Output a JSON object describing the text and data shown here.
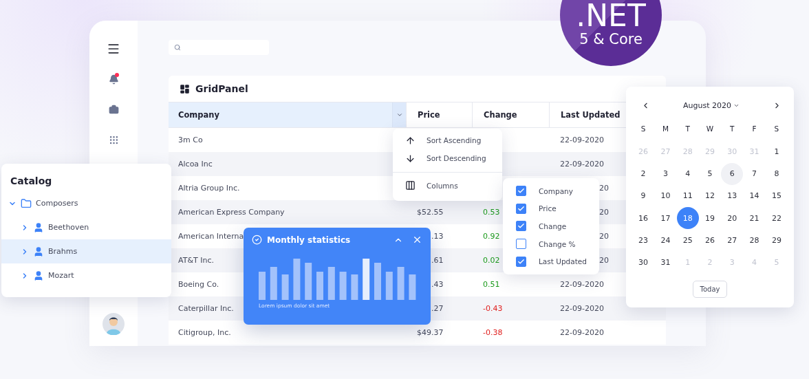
{
  "logo": {
    "title": ".NET",
    "subtitle": "5 & Core"
  },
  "sidebar": {
    "items": [
      {
        "kind": "menu"
      },
      {
        "kind": "notifications",
        "badge": true
      },
      {
        "kind": "briefcase"
      },
      {
        "kind": "apps"
      }
    ]
  },
  "grid": {
    "title": "GridPanel",
    "columns": [
      {
        "label": "Company",
        "active": true
      },
      {
        "label": "Price",
        "active": false
      },
      {
        "label": "Change",
        "active": false
      },
      {
        "label": "Last Updated",
        "active": false
      }
    ],
    "rows": [
      {
        "company": {
          "text": "3m Co"
        },
        "last_updated": {
          "text": "22-09-2020"
        }
      },
      {
        "company": {
          "text": "Alcoa Inc"
        },
        "last_updated": {
          "text": "22-09-2020"
        }
      },
      {
        "company": {
          "text": "Altria Group Inc."
        },
        "last_updated": {
          "text": "20",
          "clipped": true
        }
      },
      {
        "company": {
          "text": "American Express Company"
        },
        "price": {
          "text": "$52.55"
        },
        "change": {
          "text": "0.53",
          "color": "#1a9a1a"
        },
        "last_updated": {
          "text": "20",
          "clipped": true
        }
      },
      {
        "company": {
          "text": "American Interna"
        },
        "price": {
          "text": ".13",
          "clipped": true
        },
        "change": {
          "text": "0.92",
          "color": "#1a9a1a"
        },
        "last_updated": {
          "text": "20",
          "clipped": true
        }
      },
      {
        "company": {
          "text": "AT&T Inc."
        },
        "price": {
          "text": ".61",
          "clipped": true
        },
        "change": {
          "text": "0.02",
          "color": "#1a9a1a"
        },
        "last_updated": {
          "text": "20",
          "clipped": true
        }
      },
      {
        "company": {
          "text": "Boeing Co."
        },
        "price": {
          "text": ".43",
          "clipped": true
        },
        "change": {
          "text": "0.51",
          "color": "#1a9a1a"
        },
        "last_updated": {
          "text": "22-09-2020"
        }
      },
      {
        "company": {
          "text": "Caterpillar Inc."
        },
        "price": {
          "text": ".27",
          "clipped": true
        },
        "change": {
          "text": "-0.43",
          "color": "#e0201f"
        },
        "last_updated": {
          "text": "22-09-2020"
        }
      },
      {
        "company": {
          "text": "Citigroup, Inc."
        },
        "price": {
          "text": "$49.37"
        },
        "change": {
          "text": "-0.38",
          "color": "#e0201f"
        },
        "last_updated": {
          "text": "22-09-2020"
        }
      }
    ]
  },
  "column_menu": {
    "items": [
      {
        "kind": "sort-ascending",
        "label": "Sort Ascending"
      },
      {
        "kind": "sort-descending",
        "label": "Sort Descending"
      },
      {
        "kind": "columns",
        "label": "Columns"
      }
    ]
  },
  "column_chooser": {
    "items": [
      {
        "label": "Company",
        "checked": true
      },
      {
        "label": "Price",
        "checked": true
      },
      {
        "label": "Change",
        "checked": true
      },
      {
        "label": "Change %",
        "checked": false
      },
      {
        "label": "Last Updated",
        "checked": true
      }
    ]
  },
  "catalog": {
    "title": "Catalog",
    "tree": [
      {
        "label": "Composers",
        "kind": "folder",
        "expanded": true,
        "selected": false,
        "children": [
          {
            "label": "Beethoven",
            "kind": "person",
            "expanded": false,
            "selected": false
          },
          {
            "label": "Brahms",
            "kind": "person",
            "expanded": false,
            "selected": true
          },
          {
            "label": "Mozart",
            "kind": "person",
            "expanded": false,
            "selected": false
          }
        ]
      }
    ]
  },
  "stats": {
    "title": "Monthly statistics",
    "caption": "Lorem ipsum dolor sit amet"
  },
  "calendar": {
    "title": "August 2020",
    "weekdays": [
      "S",
      "M",
      "T",
      "W",
      "T",
      "F",
      "S"
    ],
    "days": [
      {
        "label": "26",
        "outside": true,
        "selected": false,
        "hovered": false
      },
      {
        "label": "27",
        "outside": true,
        "selected": false,
        "hovered": false
      },
      {
        "label": "28",
        "outside": true,
        "selected": false,
        "hovered": false
      },
      {
        "label": "29",
        "outside": true,
        "selected": false,
        "hovered": false
      },
      {
        "label": "30",
        "outside": true,
        "selected": false,
        "hovered": false
      },
      {
        "label": "31",
        "outside": true,
        "selected": false,
        "hovered": false
      },
      {
        "label": "1",
        "outside": false,
        "selected": false,
        "hovered": false
      },
      {
        "label": "2",
        "outside": false,
        "selected": false,
        "hovered": false
      },
      {
        "label": "3",
        "outside": false,
        "selected": false,
        "hovered": false
      },
      {
        "label": "4",
        "outside": false,
        "selected": false,
        "hovered": false
      },
      {
        "label": "5",
        "outside": false,
        "selected": false,
        "hovered": false
      },
      {
        "label": "6",
        "outside": false,
        "selected": false,
        "hovered": true
      },
      {
        "label": "7",
        "outside": false,
        "selected": false,
        "hovered": false
      },
      {
        "label": "8",
        "outside": false,
        "selected": false,
        "hovered": false
      },
      {
        "label": "9",
        "outside": false,
        "selected": false,
        "hovered": false
      },
      {
        "label": "10",
        "outside": false,
        "selected": false,
        "hovered": false
      },
      {
        "label": "11",
        "outside": false,
        "selected": false,
        "hovered": false
      },
      {
        "label": "12",
        "outside": false,
        "selected": false,
        "hovered": false
      },
      {
        "label": "13",
        "outside": false,
        "selected": false,
        "hovered": false
      },
      {
        "label": "14",
        "outside": false,
        "selected": false,
        "hovered": false
      },
      {
        "label": "15",
        "outside": false,
        "selected": false,
        "hovered": false
      },
      {
        "label": "16",
        "outside": false,
        "selected": false,
        "hovered": false
      },
      {
        "label": "17",
        "outside": false,
        "selected": false,
        "hovered": false
      },
      {
        "label": "18",
        "outside": false,
        "selected": true,
        "hovered": false
      },
      {
        "label": "19",
        "outside": false,
        "selected": false,
        "hovered": false
      },
      {
        "label": "20",
        "outside": false,
        "selected": false,
        "hovered": false
      },
      {
        "label": "21",
        "outside": false,
        "selected": false,
        "hovered": false
      },
      {
        "label": "22",
        "outside": false,
        "selected": false,
        "hovered": false
      },
      {
        "label": "23",
        "outside": false,
        "selected": false,
        "hovered": false
      },
      {
        "label": "24",
        "outside": false,
        "selected": false,
        "hovered": false
      },
      {
        "label": "25",
        "outside": false,
        "selected": false,
        "hovered": false
      },
      {
        "label": "26",
        "outside": false,
        "selected": false,
        "hovered": false
      },
      {
        "label": "27",
        "outside": false,
        "selected": false,
        "hovered": false
      },
      {
        "label": "28",
        "outside": false,
        "selected": false,
        "hovered": false
      },
      {
        "label": "29",
        "outside": false,
        "selected": false,
        "hovered": false
      },
      {
        "label": "30",
        "outside": false,
        "selected": false,
        "hovered": false
      },
      {
        "label": "31",
        "outside": false,
        "selected": false,
        "hovered": false
      },
      {
        "label": "1",
        "outside": true,
        "selected": false,
        "hovered": false
      },
      {
        "label": "2",
        "outside": true,
        "selected": false,
        "hovered": false
      },
      {
        "label": "3",
        "outside": true,
        "selected": false,
        "hovered": false
      },
      {
        "label": "4",
        "outside": true,
        "selected": false,
        "hovered": false
      },
      {
        "label": "5",
        "outside": true,
        "selected": false,
        "hovered": false
      }
    ],
    "today_button": "Today"
  }
}
